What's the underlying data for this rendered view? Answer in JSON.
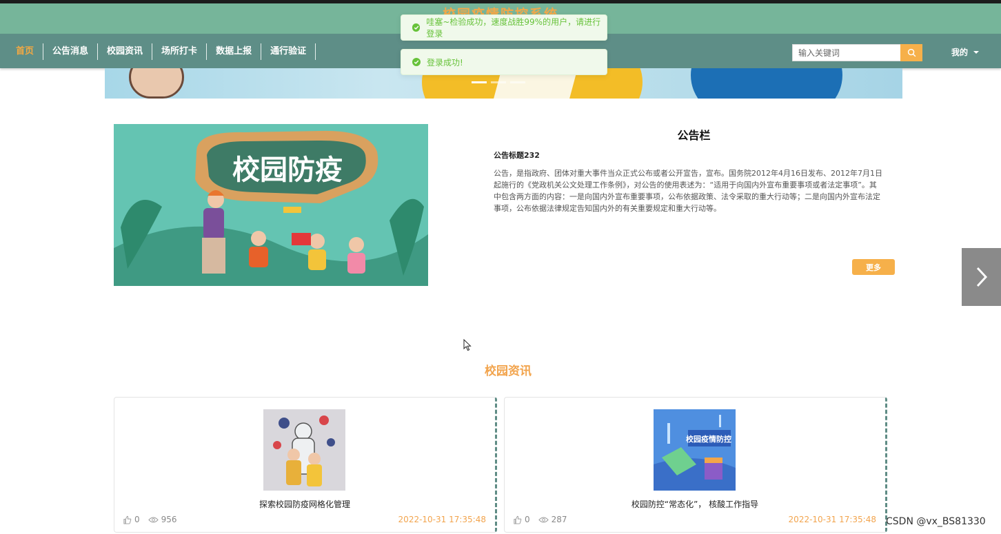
{
  "header": {
    "site_title": "校园疫情防控系统",
    "nav": [
      {
        "label": "首页",
        "active": true
      },
      {
        "label": "公告消息"
      },
      {
        "label": "校园资讯"
      },
      {
        "label": "场所打卡"
      },
      {
        "label": "数据上报"
      },
      {
        "label": "通行验证"
      }
    ],
    "search_placeholder": "输入关键词",
    "user_menu": "我的"
  },
  "toasts": [
    {
      "text": "哇塞~检验成功，速度战胜99%的用户，请进行登录",
      "type": "success"
    },
    {
      "text": "登录成功!",
      "type": "success"
    }
  ],
  "banner": {
    "slide_count": 3,
    "active_index": 0
  },
  "notice": {
    "heading": "公告栏",
    "item_title": "公告标题232",
    "content": "公告，是指政府、团体对重大事件当众正式公布或者公开宣告，宣布。国务院2012年4月16日发布、2012年7月1日起施行的《党政机关公文处理工作条例》，对公告的使用表述为：“适用于向国内外宣布重要事项或者法定事项”。其中包含两方面的内容：一是向国内外宣布重要事项，公布依据政策、法令采取的重大行动等；二是向国内外宣布法定事项，公布依据法律规定告知国内外的有关重要规定和重大行动等。",
    "image_text": "校园防疫",
    "more_label": "更多"
  },
  "news": {
    "section_title": "校园资讯",
    "items": [
      {
        "title": "探索校园防疫网格化管理",
        "likes": "0",
        "views": "956",
        "date": "2022-10-31 17:35:48"
      },
      {
        "title": "校园防控“常态化”， 核酸工作指导",
        "likes": "0",
        "views": "287",
        "date": "2022-10-31 17:35:48",
        "thumb_text": "校园疫情防控"
      }
    ]
  },
  "watermark": "CSDN @vx_BS81330",
  "colors": {
    "accent": "#f6b04a",
    "nav_bg": "#5e8e87",
    "title_bg": "#76b59a",
    "success": "#67c23a"
  }
}
